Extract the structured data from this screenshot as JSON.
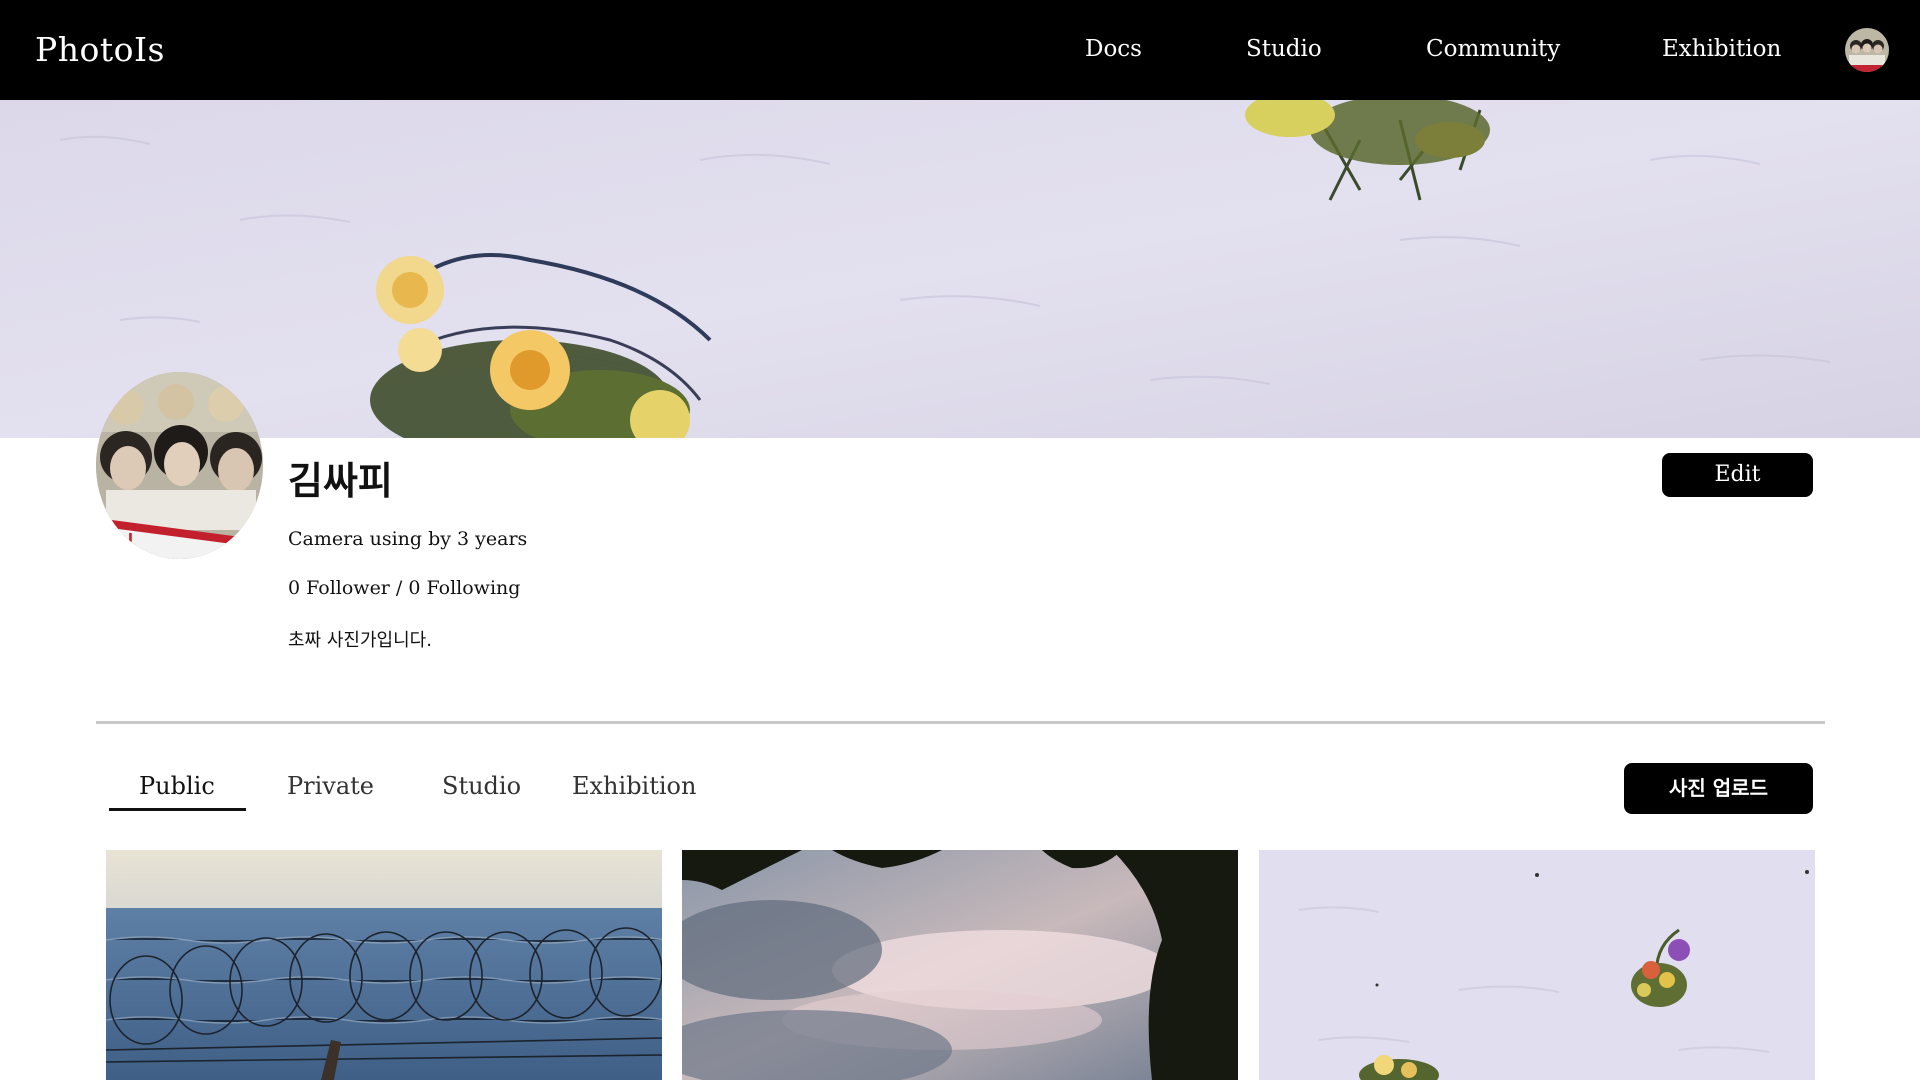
{
  "nav": {
    "brand": "PhotoIs",
    "links": [
      "Docs",
      "Studio",
      "Community",
      "Exhibition"
    ]
  },
  "profile": {
    "name": "김싸피",
    "bio": "Camera using by 3 years",
    "follow": "0 Follower / 0 Following",
    "intro": "초짜 사진가입니다.",
    "edit_label": "Edit"
  },
  "tabs": {
    "items": [
      "Public",
      "Private",
      "Studio",
      "Exhibition"
    ],
    "active": "Public",
    "upload_label": "사진 업로드"
  },
  "photos": [
    {
      "subject": "sea with barbed wire"
    },
    {
      "subject": "sky through trees"
    },
    {
      "subject": "flowers on white wall"
    }
  ],
  "colors": {
    "nav_bg": "#000000",
    "button_bg": "#000000",
    "cover_wall": "#ddd9ea"
  }
}
